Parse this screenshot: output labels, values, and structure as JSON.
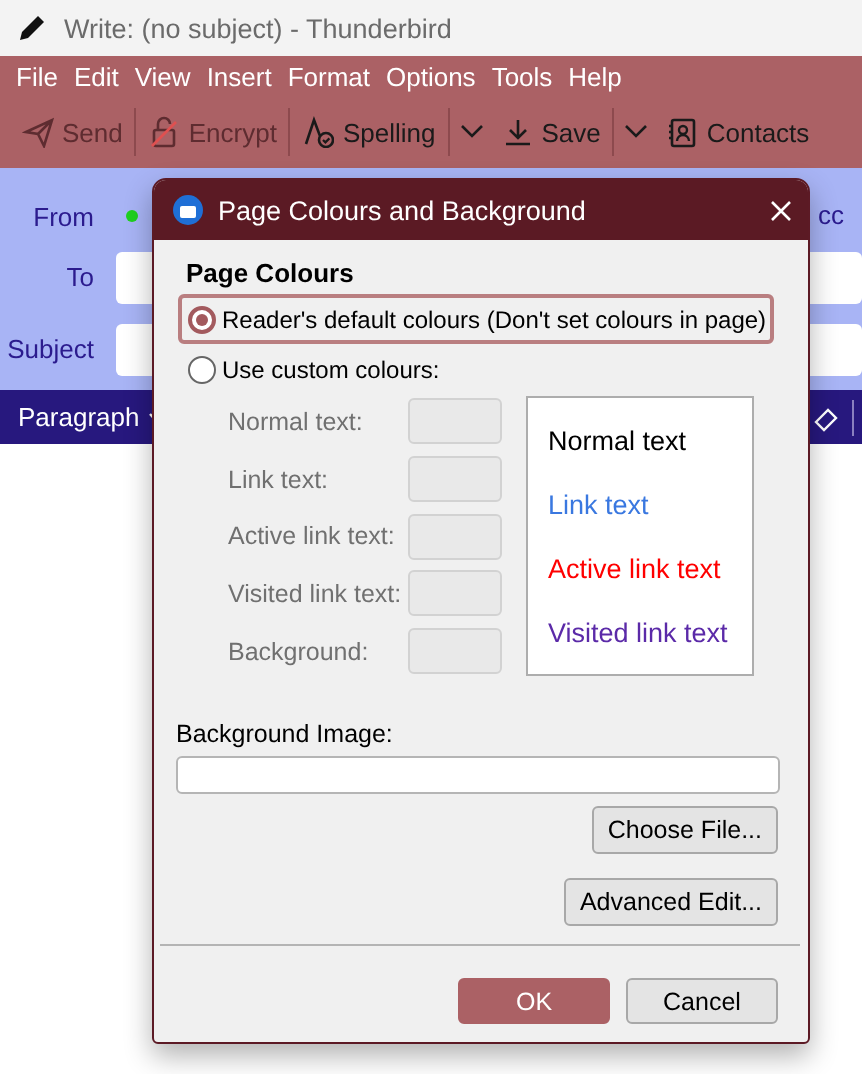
{
  "window": {
    "title": "Write: (no subject) - Thunderbird"
  },
  "menu": [
    "File",
    "Edit",
    "View",
    "Insert",
    "Format",
    "Options",
    "Tools",
    "Help"
  ],
  "toolbar": [
    {
      "label": "Send",
      "kind": "send",
      "disabled": true,
      "dropdown": false
    },
    {
      "label": "Encrypt",
      "kind": "encrypt",
      "disabled": true,
      "dropdown": false
    },
    {
      "label": "Spelling",
      "kind": "spelling",
      "disabled": false,
      "dropdown": true
    },
    {
      "label": "Save",
      "kind": "save",
      "disabled": false,
      "dropdown": true
    },
    {
      "label": "Contacts",
      "kind": "contacts",
      "disabled": false,
      "dropdown": false
    }
  ],
  "header": {
    "from_label": "From",
    "to_label": "To",
    "subject_label": "Subject",
    "cc": "cc"
  },
  "format_bar": {
    "paragraph": "Paragraph"
  },
  "dialog": {
    "title": "Page Colours and Background",
    "section": "Page Colours",
    "options": [
      {
        "label": "Reader's default colours (Don't set colours in page)",
        "selected": true
      },
      {
        "label": "Use custom colours:",
        "selected": false
      }
    ],
    "color_fields": [
      {
        "label": "Normal text:",
        "disabled": true
      },
      {
        "label": "Link text:",
        "disabled": true
      },
      {
        "label": "Active link text:",
        "disabled": true
      },
      {
        "label": "Visited link text:",
        "disabled": true
      },
      {
        "label": "Background:",
        "disabled": true
      }
    ],
    "preview": [
      {
        "text": "Normal text",
        "color": "#000000"
      },
      {
        "text": "Link text",
        "color": "#3a78e0"
      },
      {
        "text": "Active link text",
        "color": "#ff0000"
      },
      {
        "text": "Visited link text",
        "color": "#5b2aa8"
      }
    ],
    "background_image_label": "Background Image:",
    "choose_file": "Choose File...",
    "advanced_edit": "Advanced Edit...",
    "ok": "OK",
    "cancel": "Cancel"
  }
}
